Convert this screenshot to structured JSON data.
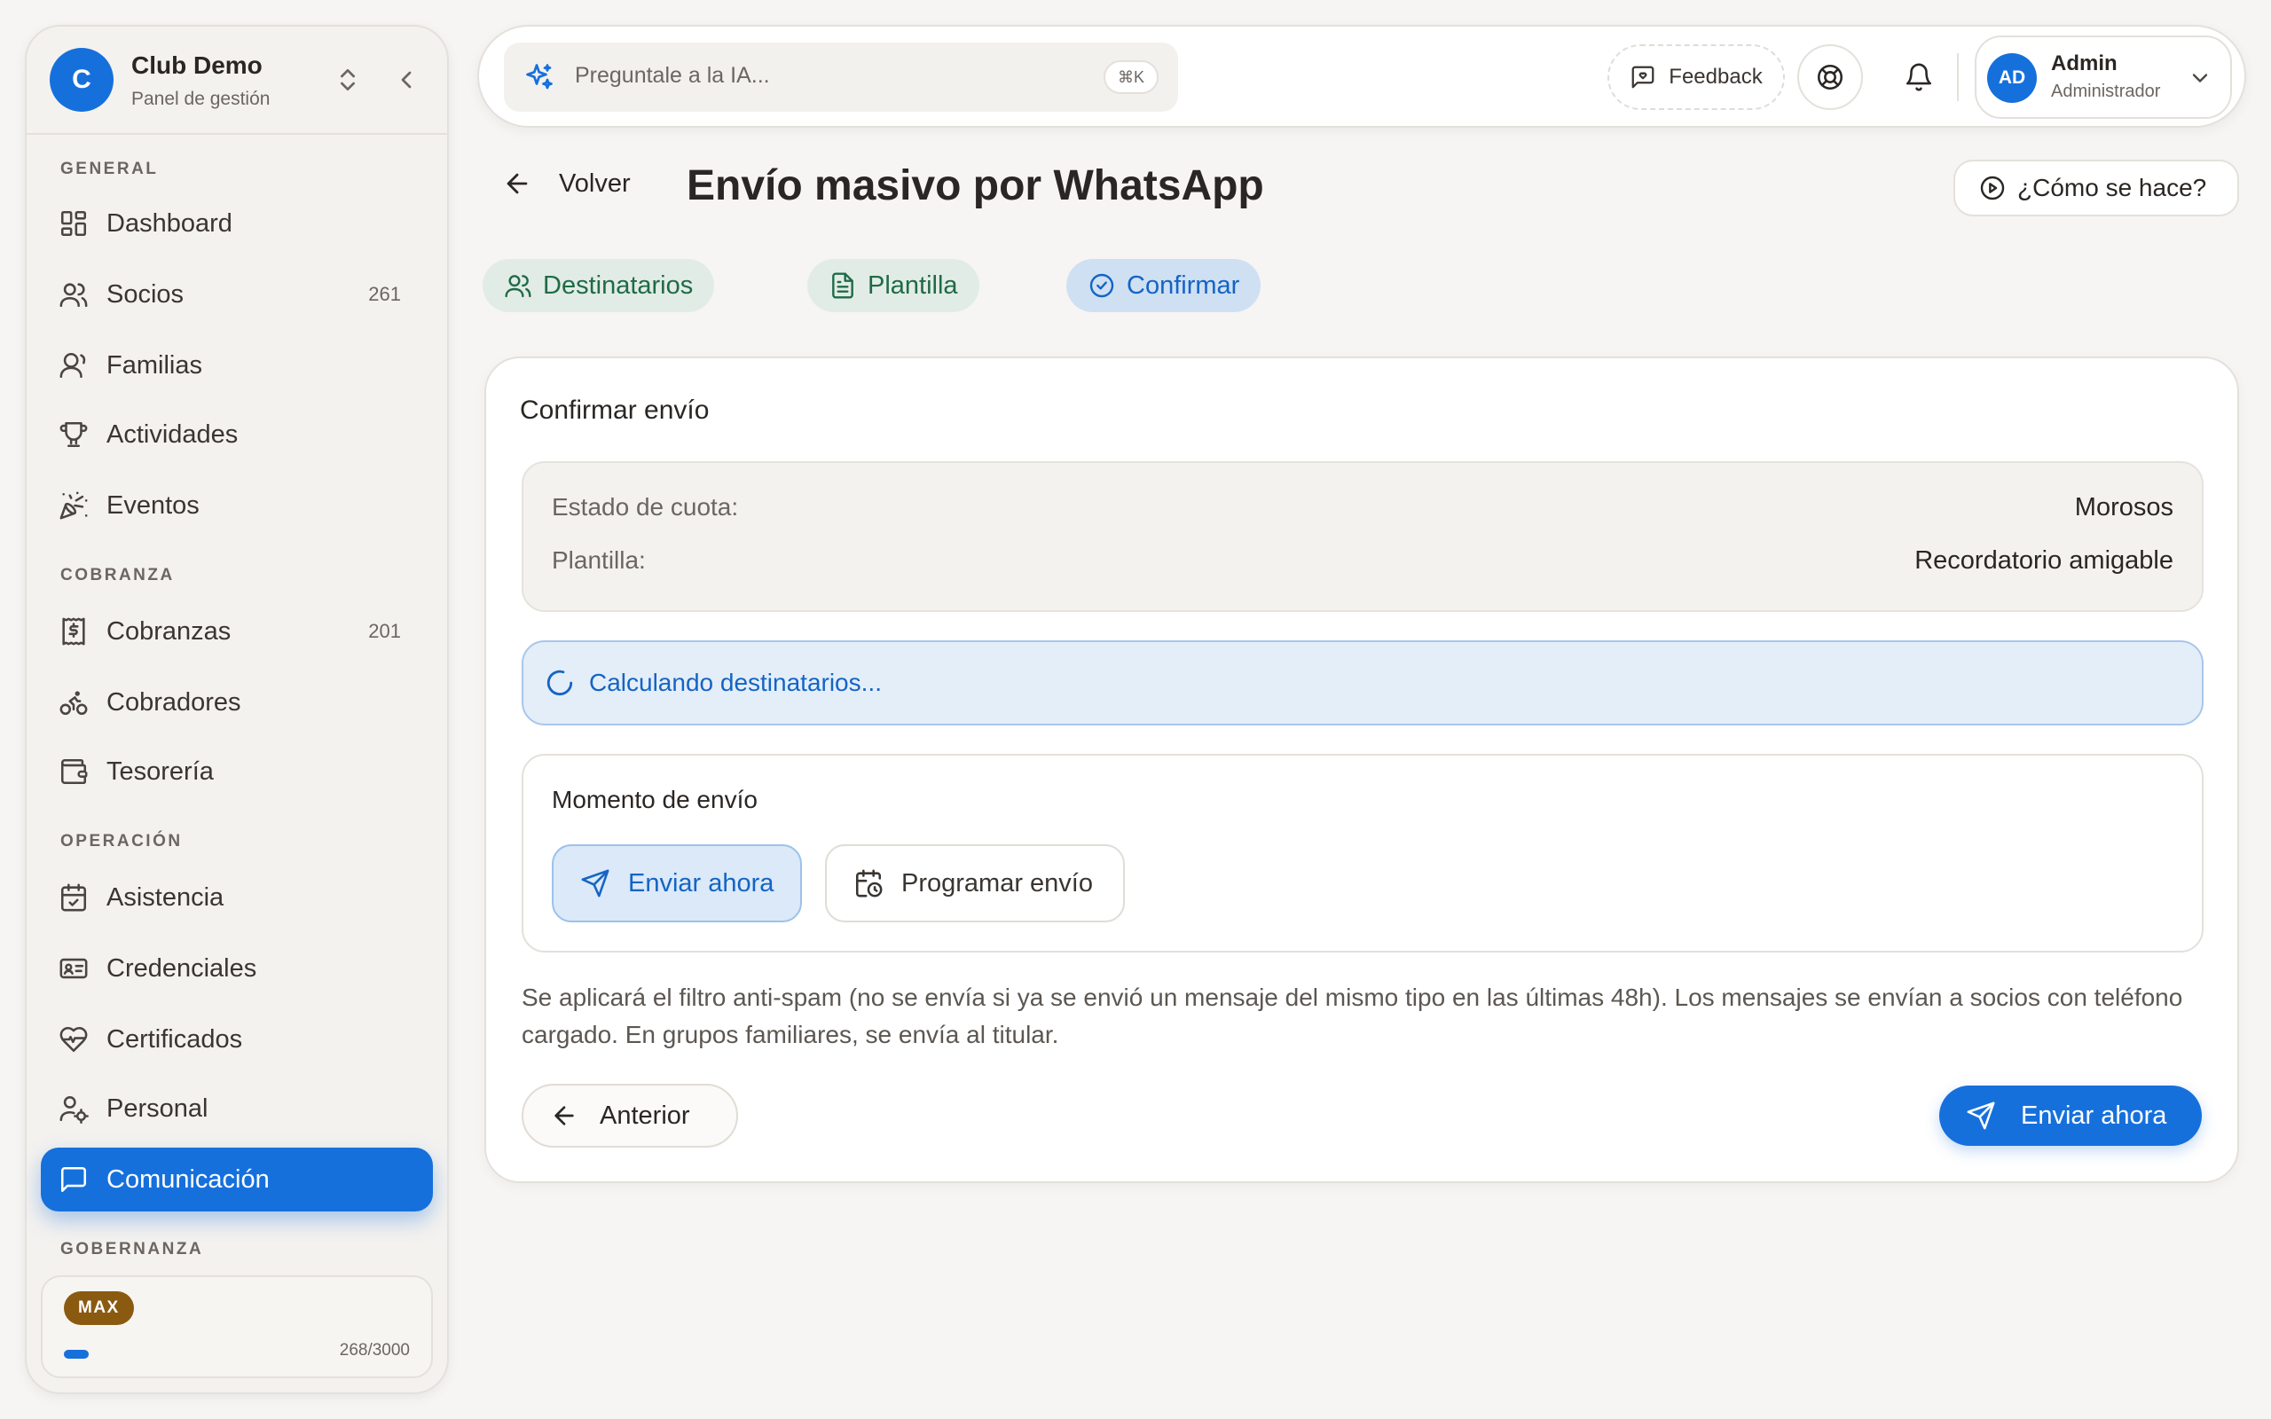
{
  "app": {
    "club_initial": "C",
    "club_name": "Club Demo",
    "club_subtitle": "Panel de gestión"
  },
  "sidebar": {
    "sections": [
      {
        "label": "GENERAL"
      },
      {
        "label": "COBRANZA"
      },
      {
        "label": "OPERACIÓN"
      },
      {
        "label": "GOBERNANZA"
      }
    ],
    "items": [
      {
        "label": "Dashboard",
        "icon": "dashboard-icon"
      },
      {
        "label": "Socios",
        "count": "261",
        "icon": "users-icon"
      },
      {
        "label": "Familias",
        "icon": "family-icon"
      },
      {
        "label": "Actividades",
        "icon": "trophy-icon"
      },
      {
        "label": "Eventos",
        "icon": "party-popper-icon"
      },
      {
        "label": "Cobranzas",
        "count": "201",
        "icon": "receipt-icon"
      },
      {
        "label": "Cobradores",
        "icon": "bike-icon"
      },
      {
        "label": "Tesorería",
        "icon": "wallet-icon"
      },
      {
        "label": "Asistencia",
        "icon": "calendar-check-icon"
      },
      {
        "label": "Credenciales",
        "icon": "id-card-icon"
      },
      {
        "label": "Certificados",
        "icon": "heart-pulse-icon"
      },
      {
        "label": "Personal",
        "icon": "user-cog-icon"
      },
      {
        "label": "Comunicación",
        "icon": "message-square-icon",
        "active": true
      }
    ],
    "plan": {
      "badge": "MAX",
      "usage": "268/3000",
      "usage_fraction": 0.089
    }
  },
  "topbar": {
    "ai_placeholder": "Preguntale a la IA...",
    "shortcut": "⌘K",
    "feedback_label": "Feedback",
    "user_initials": "AD",
    "user_name": "Admin",
    "user_role": "Administrador"
  },
  "page": {
    "back_label": "Volver",
    "title": "Envío masivo por WhatsApp",
    "howto_label": "¿Cómo se hace?",
    "steps": [
      {
        "label": "Destinatarios",
        "state": "done"
      },
      {
        "label": "Plantilla",
        "state": "done"
      },
      {
        "label": "Confirmar",
        "state": "current"
      }
    ]
  },
  "confirm": {
    "title": "Confirmar envío",
    "summary": [
      {
        "label": "Estado de cuota:",
        "value": "Morosos"
      },
      {
        "label": "Plantilla:",
        "value": "Recordatorio amigable"
      }
    ],
    "calculating": "Calculando destinatarios...",
    "moment_title": "Momento de envío",
    "option_now": "Enviar ahora",
    "option_schedule": "Programar envío",
    "note": "Se aplicará el filtro anti-spam (no se envía si ya se envió un mensaje del mismo tipo en las últimas 48h). Los mensajes se envían a socios con teléfono cargado. En grupos familiares, se envía al titular.",
    "prev_label": "Anterior",
    "send_label": "Enviar ahora"
  },
  "colors": {
    "accent": "#1670dc",
    "success": "#1f6b45",
    "background": "#f6f5f3",
    "plan_badge": "#8a5a10"
  }
}
